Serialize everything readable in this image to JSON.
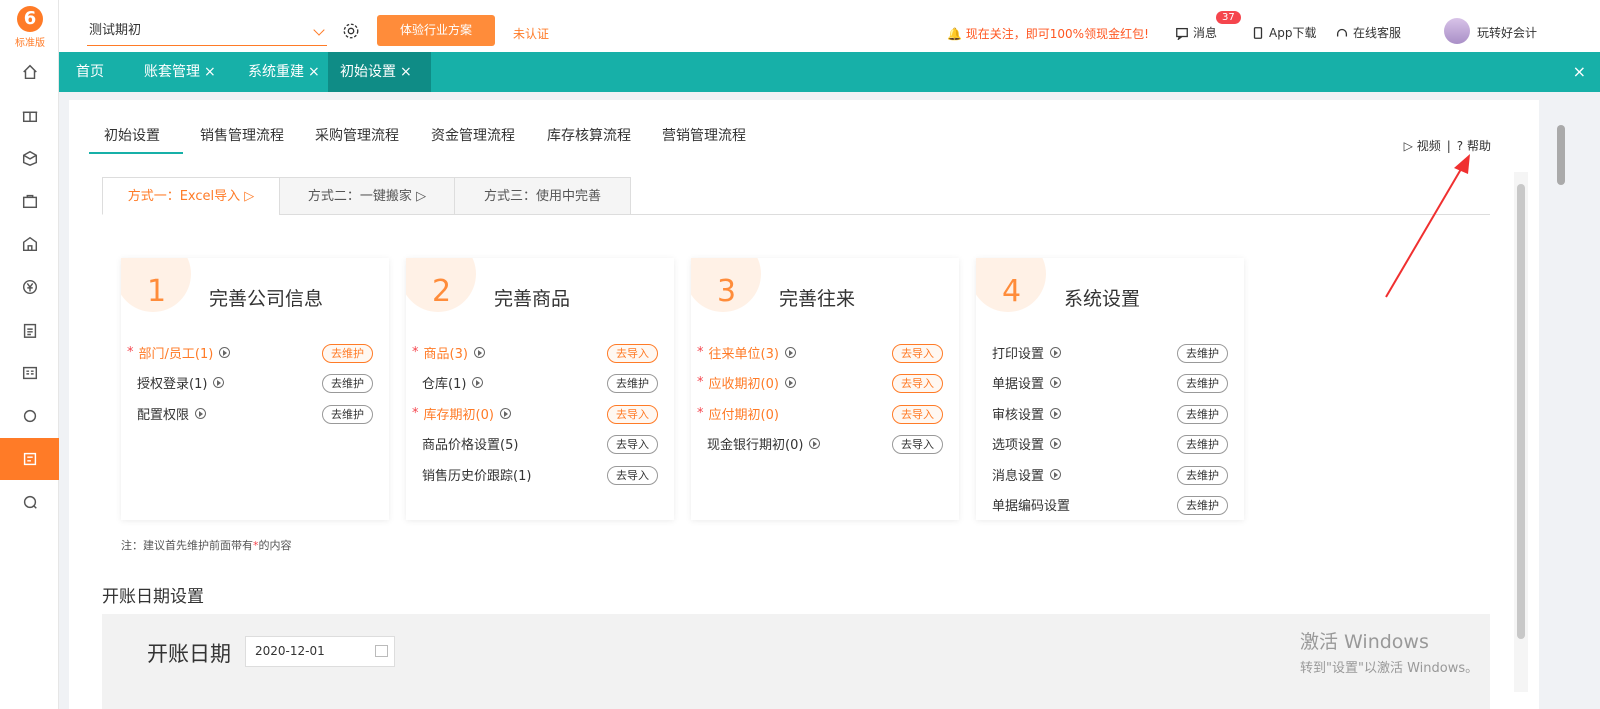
{
  "sidebar": {
    "logo_text": "标准版",
    "icons": [
      "home-icon",
      "gift-icon",
      "box-icon",
      "bag-icon",
      "building-icon",
      "yen-icon",
      "clipboard-icon",
      "list-icon",
      "refresh-icon",
      "settings-panel-icon",
      "chat-icon"
    ]
  },
  "topbar": {
    "account_name": "测试期初",
    "trial_button": "体验行业方案",
    "unverified": "未认证",
    "promo": "现在关注，即可100%领现金红包!",
    "messages_label": "消息",
    "messages_count": "37",
    "app_download": "App下载",
    "online_service": "在线客服",
    "user_name": "玩转好会计"
  },
  "tabs": [
    {
      "label": "首页"
    },
    {
      "label": "账套管理",
      "close": "×"
    },
    {
      "label": "系统重建",
      "close": "×"
    },
    {
      "label": "初始设置",
      "close": "×"
    }
  ],
  "tab_close_all": "×",
  "subtabs": [
    "初始设置",
    "销售管理流程",
    "采购管理流程",
    "资金管理流程",
    "库存核算流程",
    "营销管理流程"
  ],
  "help": {
    "video": "视频",
    "sep": "|",
    "help": "帮助"
  },
  "modes": [
    "方式一：Excel导入",
    "方式二：一键搬家",
    "方式三：使用中完善"
  ],
  "cards": [
    {
      "num": "1",
      "title": "完善公司信息",
      "items": [
        {
          "label": "部门/员工(1)",
          "required": true,
          "action": "去维护"
        },
        {
          "label": "授权登录(1)",
          "required": false,
          "action": "去维护"
        },
        {
          "label": "配置权限",
          "required": false,
          "action": "去维护"
        }
      ]
    },
    {
      "num": "2",
      "title": "完善商品",
      "items": [
        {
          "label": "商品(3)",
          "required": true,
          "action": "去导入"
        },
        {
          "label": "仓库(1)",
          "required": false,
          "action": "去维护"
        },
        {
          "label": "库存期初(0)",
          "required": true,
          "action": "去导入"
        },
        {
          "label": "商品价格设置(5)",
          "required": false,
          "action": "去导入"
        },
        {
          "label": "销售历史价跟踪(1)",
          "required": false,
          "action": "去导入"
        }
      ]
    },
    {
      "num": "3",
      "title": "完善往来",
      "items": [
        {
          "label": "往来单位(3)",
          "required": true,
          "action": "去导入"
        },
        {
          "label": "应收期初(0)",
          "required": true,
          "action": "去导入"
        },
        {
          "label": "应付期初(0)",
          "required": true,
          "action": "去导入"
        },
        {
          "label": "现金银行期初(0)",
          "required": false,
          "action": "去导入"
        }
      ]
    },
    {
      "num": "4",
      "title": "系统设置",
      "items": [
        {
          "label": "打印设置",
          "required": false,
          "action": "去维护"
        },
        {
          "label": "单据设置",
          "required": false,
          "action": "去维护"
        },
        {
          "label": "审核设置",
          "required": false,
          "action": "去维护"
        },
        {
          "label": "选项设置",
          "required": false,
          "action": "去维护"
        },
        {
          "label": "消息设置",
          "required": false,
          "action": "去维护"
        },
        {
          "label": "单据编码设置",
          "required": false,
          "action": "去维护"
        }
      ]
    }
  ],
  "note": {
    "prefix": "注：建议首先维护前面带有",
    "star": "*",
    "suffix": "的内容"
  },
  "date_section": {
    "title": "开账日期设置",
    "label": "开账日期",
    "value": "2020-12-01"
  },
  "windows_activation": {
    "line1": "激活 Windows",
    "line2": "转到\"设置\"以激活 Windows。"
  },
  "colors": {
    "accent": "#ff7b27",
    "teal": "#17b0a8",
    "teal_dark": "#0f8c86",
    "required_star": "#f5454d"
  }
}
